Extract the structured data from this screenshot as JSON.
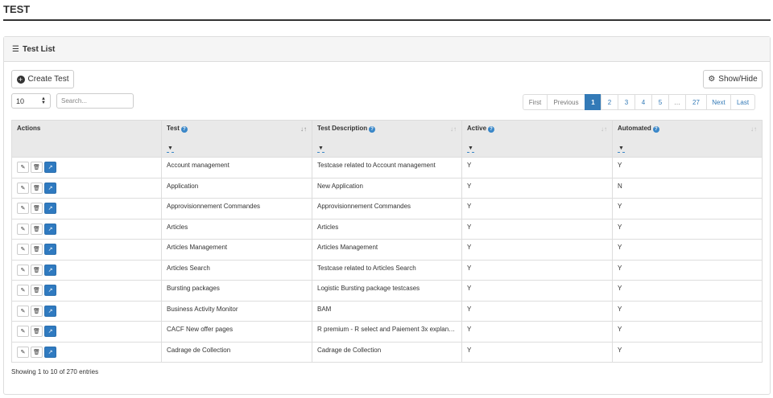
{
  "page": {
    "title": "TEST"
  },
  "panel": {
    "heading": "Test List"
  },
  "toolbar": {
    "create_label": "Create Test",
    "showhide_label": "Show/Hide"
  },
  "length_select": {
    "value": "10"
  },
  "search": {
    "placeholder": "Search..."
  },
  "pagination": {
    "items": [
      {
        "label": "First"
      },
      {
        "label": "Previous"
      },
      {
        "label": "1"
      },
      {
        "label": "2"
      },
      {
        "label": "3"
      },
      {
        "label": "4"
      },
      {
        "label": "5"
      },
      {
        "label": "…"
      },
      {
        "label": "27"
      },
      {
        "label": "Next"
      },
      {
        "label": "Last"
      }
    ],
    "active": "1"
  },
  "table": {
    "columns": [
      "Actions",
      "Test",
      "Test Description",
      "Active",
      "Automated"
    ],
    "rows": [
      {
        "test": "Account management",
        "description": "Testcase related to Account management",
        "active": "Y",
        "automated": "Y"
      },
      {
        "test": "Application",
        "description": "New Application",
        "active": "Y",
        "automated": "N"
      },
      {
        "test": "Approvisionnement Commandes",
        "description": "Approvisionnement Commandes",
        "active": "Y",
        "automated": "Y"
      },
      {
        "test": "Articles",
        "description": "Articles",
        "active": "Y",
        "automated": "Y"
      },
      {
        "test": "Articles Management",
        "description": "Articles Management",
        "active": "Y",
        "automated": "Y"
      },
      {
        "test": "Articles Search",
        "description": "Testcase related to Articles Search",
        "active": "Y",
        "automated": "Y"
      },
      {
        "test": "Bursting packages",
        "description": "Logistic Bursting package testcases",
        "active": "Y",
        "automated": "Y"
      },
      {
        "test": "Business Activity Monitor",
        "description": "BAM",
        "active": "Y",
        "automated": "Y"
      },
      {
        "test": "CACF New offer pages",
        "description": "R premium - R select and Paiement 3x explan…",
        "active": "Y",
        "automated": "Y"
      },
      {
        "test": "Cadrage de Collection",
        "description": "Cadrage de Collection",
        "active": "Y",
        "automated": "Y"
      }
    ]
  },
  "footer": {
    "entries_info": "Showing 1 to 10 of 270 entries"
  },
  "colors": {
    "primary": "#337ab7",
    "header_bg": "#e9e9e9",
    "panel_heading_bg": "#f5f5f5"
  }
}
